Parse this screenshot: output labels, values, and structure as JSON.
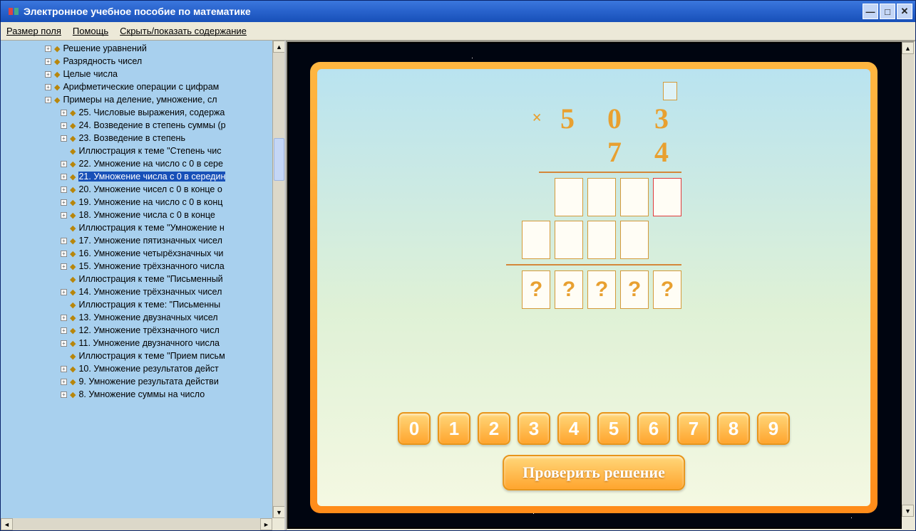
{
  "window": {
    "title": "Электронное учебное пособие по математике"
  },
  "menu": {
    "field_size": "Размер поля",
    "help": "Помощь",
    "toggle_toc": "Скрыть/показать содержание"
  },
  "tree": {
    "items": [
      {
        "indent": 84,
        "exp": "+",
        "text": "8. Умножение суммы на число"
      },
      {
        "indent": 84,
        "exp": "+",
        "text": "9. Умножение результата действи"
      },
      {
        "indent": 84,
        "exp": "+",
        "text": "10. Умножение результатов дейст"
      },
      {
        "indent": 84,
        "exp": "",
        "text": "Иллюстрация к теме \"Прием письм"
      },
      {
        "indent": 84,
        "exp": "+",
        "text": "11. Умножение двузначного числа"
      },
      {
        "indent": 84,
        "exp": "+",
        "text": "12. Умножение трёхзначного числ"
      },
      {
        "indent": 84,
        "exp": "+",
        "text": "13. Умножение двузначных чисел"
      },
      {
        "indent": 84,
        "exp": "",
        "text": "Иллюстрация к теме: \"Письменны"
      },
      {
        "indent": 84,
        "exp": "+",
        "text": "14. Умножение трёхзначных чисел"
      },
      {
        "indent": 84,
        "exp": "",
        "text": "Иллюстрация к теме \"Письменный"
      },
      {
        "indent": 84,
        "exp": "+",
        "text": "15. Умножение трёхзначного числа"
      },
      {
        "indent": 84,
        "exp": "+",
        "text": "16. Умножение четырёхзначных чи"
      },
      {
        "indent": 84,
        "exp": "+",
        "text": "17. Умножение пятизначных чисел"
      },
      {
        "indent": 84,
        "exp": "",
        "text": "Иллюстрация к теме \"Умножение н"
      },
      {
        "indent": 84,
        "exp": "+",
        "text": "18. Умножение числа с 0 в конце"
      },
      {
        "indent": 84,
        "exp": "+",
        "text": "19. Умножение на число с 0 в конц"
      },
      {
        "indent": 84,
        "exp": "+",
        "text": "20. Умножение чисел с 0 в конце о"
      },
      {
        "indent": 84,
        "exp": "+",
        "text": "21. Умножение числа с 0 в середин",
        "selected": true
      },
      {
        "indent": 84,
        "exp": "+",
        "text": "22. Умножение на число с 0 в сере"
      },
      {
        "indent": 84,
        "exp": "",
        "text": "Иллюстрация к теме \"Степень чис"
      },
      {
        "indent": 84,
        "exp": "+",
        "text": "23. Возведение в степень"
      },
      {
        "indent": 84,
        "exp": "+",
        "text": "24. Возведение в степень суммы (р"
      },
      {
        "indent": 84,
        "exp": "+",
        "text": "25. Числовые выражения, содержа"
      },
      {
        "indent": 62,
        "exp": "+",
        "text": "Примеры на деление, умножение, сл"
      },
      {
        "indent": 62,
        "exp": "+",
        "text": "Арифметические операции с цифрам"
      },
      {
        "indent": 62,
        "exp": "+",
        "text": "Целые числа"
      },
      {
        "indent": 62,
        "exp": "+",
        "text": "Разрядность чисел"
      },
      {
        "indent": 62,
        "exp": "+",
        "text": "Решение уравнений"
      }
    ]
  },
  "problem": {
    "operand1": "5 0 3",
    "operand2": "7 4",
    "operator": "×",
    "result_placeholder": "?"
  },
  "digits": [
    "0",
    "1",
    "2",
    "3",
    "4",
    "5",
    "6",
    "7",
    "8",
    "9"
  ],
  "buttons": {
    "check": "Проверить решение"
  }
}
